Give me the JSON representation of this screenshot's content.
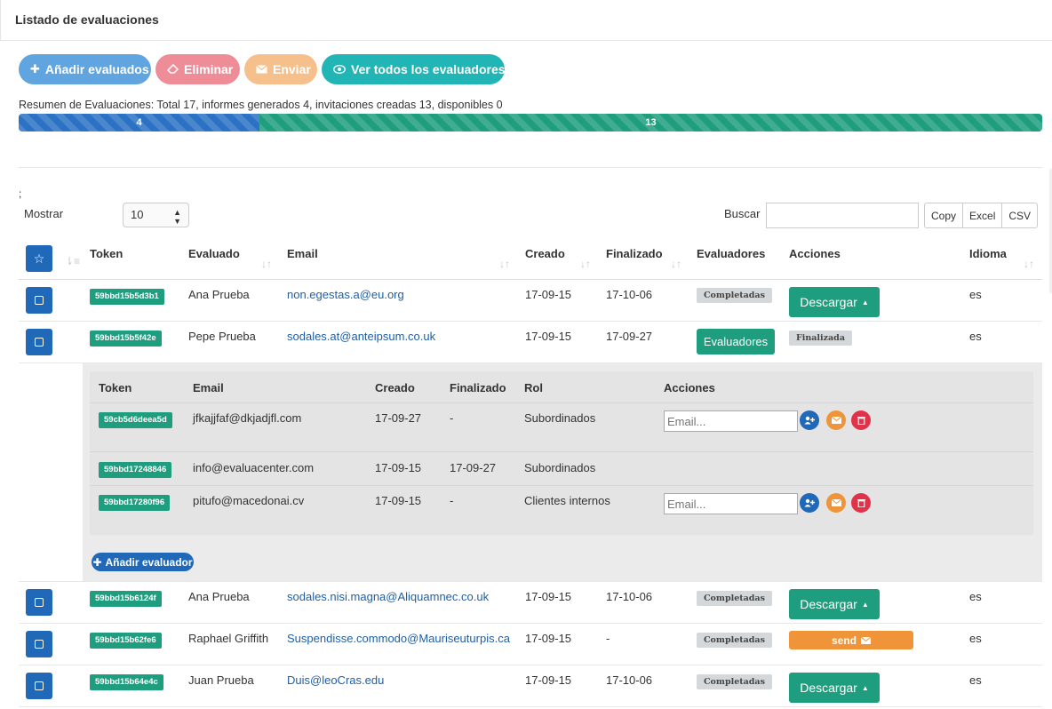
{
  "panel": {
    "title": "Listado de evaluaciones"
  },
  "toolbar": {
    "add_label": "Añadir evaluados",
    "delete_label": "Eliminar",
    "send_label": "Enviar",
    "view_all_label": "Ver todos los evaluadores"
  },
  "summary": {
    "text": "Resumen de Evaluaciones: Total 17, informes generados 4, invitaciones creadas 13, disponibles 0",
    "generated": "4",
    "created": "13",
    "generated_fraction": 0.2353,
    "created_fraction": 0.7647,
    "colors": {
      "generated": "#2b72c4",
      "created": "#1e9e7e"
    }
  },
  "controls": {
    "semicolon": ";",
    "show_label": "Mostrar",
    "show_value": "10",
    "search_label": "Buscar",
    "search_value": "",
    "export": [
      "Copy",
      "Excel",
      "CSV"
    ]
  },
  "table": {
    "headers": {
      "token": "Token",
      "evaluado": "Evaluado",
      "email": "Email",
      "creado": "Creado",
      "finalizado": "Finalizado",
      "evaluadores": "Evaluadores",
      "acciones": "Acciones",
      "idioma": "Idioma"
    },
    "rows": [
      {
        "token": "59bbd15b5d3b1",
        "evaluado": "Ana Prueba",
        "email": "non.egestas.a@eu.org",
        "creado": "17-09-15",
        "finalizado": "17-10-06",
        "evaluadores": "Completadas",
        "accion": "Descargar",
        "idioma": "es"
      },
      {
        "token": "59bbd15b5f42e",
        "evaluado": "Pepe Prueba",
        "email": "sodales.at@anteipsum.co.uk",
        "creado": "17-09-15",
        "finalizado": "17-09-27",
        "evaluadores": "Evaluadores",
        "accion": "Finalizada",
        "idioma": "es"
      },
      {
        "token": "59bbd15b6124f",
        "evaluado": "Ana Prueba",
        "email": "sodales.nisi.magna@Aliquamnec.co.uk",
        "creado": "17-09-15",
        "finalizado": "17-10-06",
        "evaluadores": "Completadas",
        "accion": "Descargar",
        "idioma": "es"
      },
      {
        "token": "59bbd15b62fe6",
        "evaluado": "Raphael Griffith",
        "email": "Suspendisse.commodo@Mauriseuturpis.ca",
        "creado": "17-09-15",
        "finalizado": "-",
        "evaluadores": "Completadas",
        "accion": "send",
        "idioma": "es"
      },
      {
        "token": "59bbd15b64e4c",
        "evaluado": "Juan Prueba",
        "email": "Duis@leoCras.edu",
        "creado": "17-09-15",
        "finalizado": "17-10-06",
        "evaluadores": "Completadas",
        "accion": "Descargar",
        "idioma": "es"
      }
    ]
  },
  "subtable": {
    "headers": {
      "token": "Token",
      "email": "Email",
      "creado": "Creado",
      "finalizado": "Finalizado",
      "rol": "Rol",
      "acciones": "Acciones"
    },
    "rows": [
      {
        "token": "59cb5d6deea5d",
        "email": "jfkajjfaf@dkjadjfl.com",
        "creado": "17-09-27",
        "finalizado": "-",
        "rol": "Subordinados",
        "email_placeholder": "Email..."
      },
      {
        "token": "59bbd17248846",
        "email": "info@evaluacenter.com",
        "creado": "17-09-15",
        "finalizado": "17-09-27",
        "rol": "Subordinados"
      },
      {
        "token": "59bbd17280f96",
        "email": "pitufo@macedonai.cv",
        "creado": "17-09-15",
        "finalizado": "-",
        "rol": "Clientes internos",
        "email_placeholder": "Email..."
      }
    ],
    "add_label": "Añadir evaluador"
  },
  "icons": {
    "plus": "plus-icon",
    "eraser": "eraser-icon",
    "envelope": "envelope-icon",
    "eye": "eye-icon",
    "star": "star-icon",
    "sort": "sort-icon",
    "caret_up": "caret-up-icon",
    "user_plus": "user-plus-icon",
    "trash": "trash-icon"
  }
}
